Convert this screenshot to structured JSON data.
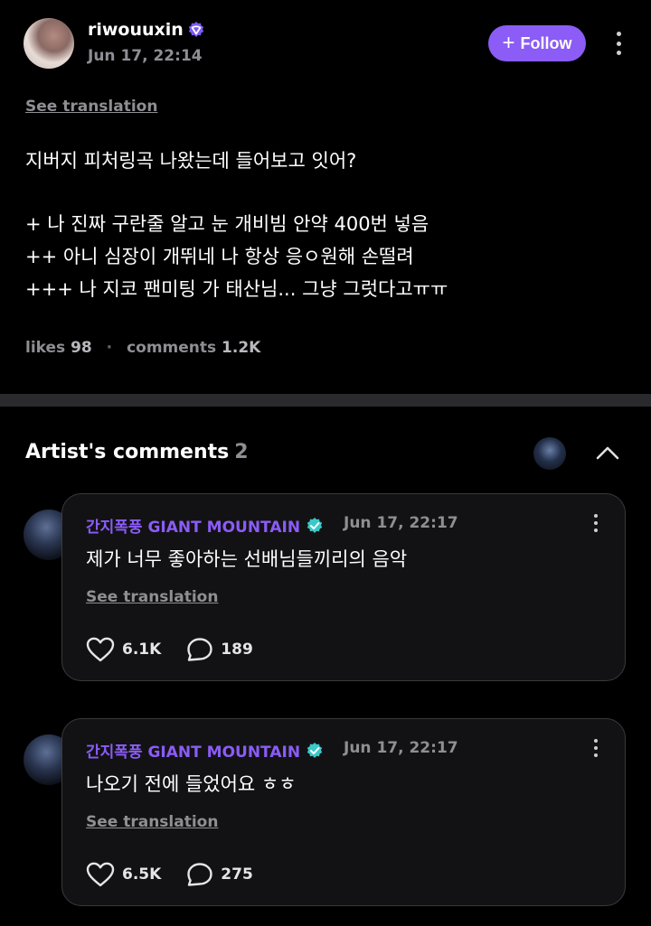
{
  "post": {
    "username": "riwouuxin",
    "timestamp": "Jun 17, 22:14",
    "follow_label": "Follow",
    "see_translation": "See translation",
    "body_lines": [
      "지버지 피처링곡 나왔는데 들어보고 잇어?",
      "",
      "+ 나 진짜 구란줄 알고 눈 개비빔 안약 400번 넣음",
      "++ 아니 심장이 개뛰네 나 항상 응ㅇ원해 손떨려",
      "+++ 나 지코 팬미팅 가 태산님... 그냥 그럿다고ㅠㅠ"
    ],
    "likes_label": "likes",
    "likes_count": "98",
    "comments_label": "comments",
    "comments_count": "1.2K"
  },
  "artist_comments": {
    "title": "Artist's comments",
    "count": "2",
    "items": [
      {
        "author": "간지폭풍 GIANT MOUNTAIN",
        "time": "Jun 17, 22:17",
        "text": "제가 너무 좋아하는 선배님들끼리의 음악",
        "see_translation": "See translation",
        "likes": "6.1K",
        "replies": "189"
      },
      {
        "author": "간지폭풍 GIANT MOUNTAIN",
        "time": "Jun 17, 22:17",
        "text": "나오기 전에 들었어요 ㅎㅎ",
        "see_translation": "See translation",
        "likes": "6.5K",
        "replies": "275"
      }
    ]
  },
  "colors": {
    "accent": "#8b5cf6",
    "muted": "#8e8e93",
    "background": "#000000",
    "card": "#121214"
  }
}
